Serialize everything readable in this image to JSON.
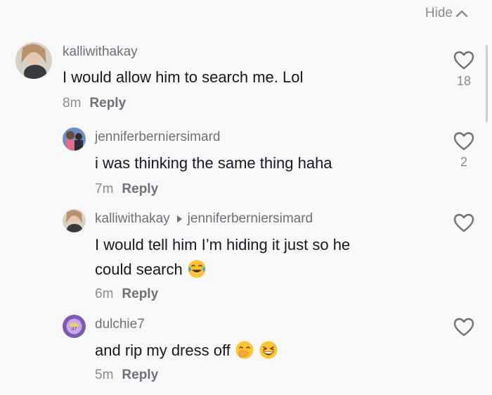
{
  "header": {
    "hide_label": "Hide"
  },
  "comments": [
    {
      "username": "kalliwithakay",
      "lines": [
        "I would allow him to search me. Lol"
      ],
      "time": "8m",
      "reply_label": "Reply",
      "likes": "18"
    },
    {
      "username": "jenniferberniersimard",
      "lines": [
        "i was thinking the same thing haha"
      ],
      "time": "7m",
      "reply_label": "Reply",
      "likes": "2"
    },
    {
      "username": "kalliwithakay",
      "reply_to": "jenniferberniersimard",
      "lines": [
        "I would tell him I’m hiding it just so he",
        "could search"
      ],
      "emojis": [
        "tears-of-joy-emoji"
      ],
      "time": "6m",
      "reply_label": "Reply",
      "likes": ""
    },
    {
      "username": "dulchie7",
      "lines": [
        "and rip my dress off"
      ],
      "emojis": [
        "face-with-hand-over-mouth-emoji",
        "grinning-squinting-face-emoji"
      ],
      "time": "5m",
      "reply_label": "Reply",
      "likes": ""
    }
  ],
  "colors": {
    "background": "#f8f8f8",
    "text": "#161823",
    "muted": "#8a8b91",
    "username": "#6f7079"
  }
}
